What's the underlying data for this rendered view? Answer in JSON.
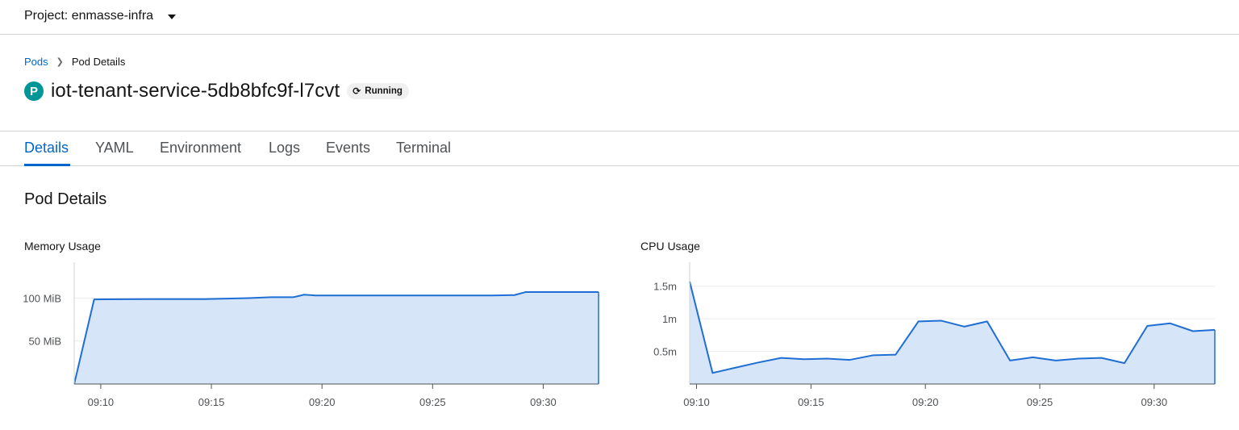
{
  "header": {
    "project_label": "Project: enmasse-infra"
  },
  "breadcrumb": {
    "parent": "Pods",
    "separator": ">",
    "current": "Pod Details"
  },
  "resource": {
    "badge_letter": "P",
    "name": "iot-tenant-service-5db8bfc9f-l7cvt",
    "status": "Running",
    "badge_color": "#009596"
  },
  "tabs": [
    {
      "label": "Details",
      "active": true
    },
    {
      "label": "YAML",
      "active": false
    },
    {
      "label": "Environment",
      "active": false
    },
    {
      "label": "Logs",
      "active": false
    },
    {
      "label": "Events",
      "active": false
    },
    {
      "label": "Terminal",
      "active": false
    }
  ],
  "section": {
    "title": "Pod Details"
  },
  "chart_data": [
    {
      "type": "area",
      "title": "Memory Usage",
      "unit": "MiB",
      "y_ticks": [
        {
          "value": 50,
          "label": "50 MiB"
        },
        {
          "value": 100,
          "label": "100 MiB"
        }
      ],
      "x_ticks": [
        "09:10",
        "09:15",
        "09:20",
        "09:25",
        "09:30"
      ],
      "ylim": [
        0,
        123
      ],
      "xlim_min": [
        8.8,
        32.5
      ],
      "grid": true,
      "color": "#1f6ed4",
      "fill": "#d6e5f7",
      "points": [
        [
          8.8,
          0
        ],
        [
          9.7,
          98.5
        ],
        [
          12.2,
          98.8
        ],
        [
          14.7,
          98.8
        ],
        [
          16.7,
          100
        ],
        [
          17.7,
          101
        ],
        [
          18.7,
          101
        ],
        [
          19.2,
          104
        ],
        [
          19.7,
          103
        ],
        [
          22.7,
          103
        ],
        [
          27.7,
          103
        ],
        [
          28.7,
          103.5
        ],
        [
          29.2,
          107
        ],
        [
          32.5,
          107
        ]
      ]
    },
    {
      "type": "area",
      "title": "CPU Usage",
      "unit": "m",
      "y_ticks": [
        {
          "value": 0.5,
          "label": "0.5m"
        },
        {
          "value": 1,
          "label": "1m"
        },
        {
          "value": 1.5,
          "label": "1.5m"
        }
      ],
      "x_ticks": [
        "09:10",
        "09:15",
        "09:20",
        "09:25",
        "09:30"
      ],
      "ylim": [
        0,
        1.62
      ],
      "xlim_min": [
        9.7,
        32.65
      ],
      "grid": true,
      "color": "#1f6ed4",
      "fill": "#d6e5f7",
      "points": [
        [
          9.7,
          1.57
        ],
        [
          10.7,
          0.17
        ],
        [
          11.7,
          0.25
        ],
        [
          12.7,
          0.33
        ],
        [
          13.7,
          0.4
        ],
        [
          14.7,
          0.38
        ],
        [
          15.7,
          0.39
        ],
        [
          16.7,
          0.37
        ],
        [
          17.7,
          0.44
        ],
        [
          18.7,
          0.45
        ],
        [
          19.7,
          0.96
        ],
        [
          20.7,
          0.97
        ],
        [
          21.7,
          0.88
        ],
        [
          22.7,
          0.96
        ],
        [
          23.7,
          0.36
        ],
        [
          24.7,
          0.41
        ],
        [
          25.7,
          0.36
        ],
        [
          26.7,
          0.39
        ],
        [
          27.7,
          0.4
        ],
        [
          28.7,
          0.32
        ],
        [
          29.7,
          0.89
        ],
        [
          30.7,
          0.93
        ],
        [
          31.7,
          0.81
        ],
        [
          32.65,
          0.83
        ]
      ]
    }
  ]
}
